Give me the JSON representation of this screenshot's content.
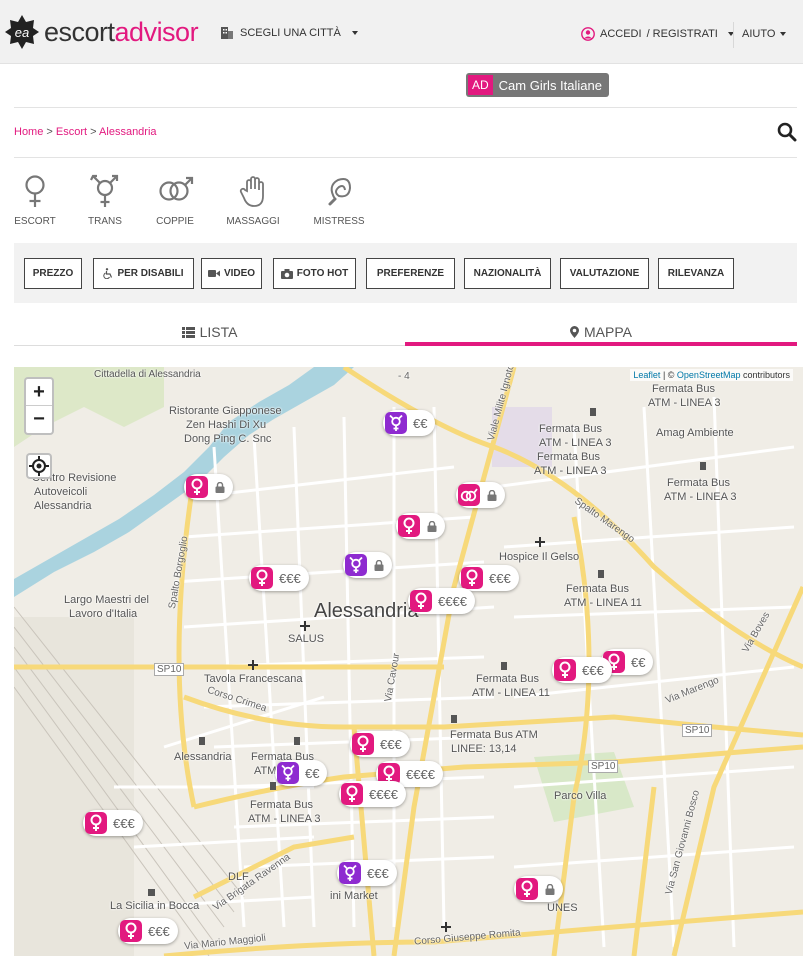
{
  "header": {
    "logo_part1": "escort",
    "logo_part2": "advisor",
    "logo_badge": "ea",
    "city_label": "SCEGLI UNA CITTÀ",
    "login_label": "ACCEDI",
    "register_label": "/ REGISTRATI",
    "help_label": "AIUTO"
  },
  "ad": {
    "tag": "AD",
    "label": "Cam Girls Italiane"
  },
  "breadcrumb": {
    "home": "Home",
    "sep": ">",
    "escort": "Escort",
    "city": "Alessandria"
  },
  "categories": [
    "ESCORT",
    "TRANS",
    "COPPIE",
    "MASSAGGI",
    "MISTRESS"
  ],
  "filters": [
    "PREZZO",
    "PER DISABILI",
    "VIDEO",
    "FOTO HOT",
    "PREFERENZE",
    "NAZIONALITÀ",
    "VALUTAZIONE",
    "RILEVANZA"
  ],
  "tabs": {
    "list": "LISTA",
    "map": "MAPPA"
  },
  "map": {
    "zoom_in": "+",
    "zoom_out": "−",
    "attribution_leaflet": "Leaflet",
    "attribution_sep": " | © ",
    "attribution_osm": "OpenStreetMap",
    "attribution_tail": " contributors",
    "city_name": "Alessandria",
    "labels": {
      "l1": "Ristorante Giapponese",
      "l2": "Zen Hashi Di Xu",
      "l3": "Dong Ping C. Snc",
      "l4": "Centro Revisione",
      "l5": "Autoveicoli",
      "l6": "Alessandria",
      "l7": "Largo Maestri del",
      "l8": "Lavoro d'Italia",
      "l9": "SALUS",
      "l10": "Tavola Francescana",
      "l11": "Corso Crimea",
      "l12": "Hospice Il Gelso",
      "l13": "Fermata Bus",
      "l14": "ATM - LINEA 3",
      "l15": "Amag Ambiente",
      "l16": "Fermata Bus",
      "l17": "ATM - LINEA 11",
      "l18": "Parco Villa",
      "l19": "Via Marengo",
      "l20": "Spalto Marengo",
      "l21": "Via Cavour",
      "l22": "Spalto Borgoglio",
      "l23": "Viale Milite Ignoto",
      "l24": "Via Brigata Ravenna",
      "l25": "Via Mario Maggioli",
      "l26": "Corso Giuseppe Romita",
      "l27": "La Sicilia in Bocca",
      "l28": "DLF",
      "l29": "SP10",
      "l30": "Via Boves",
      "l31": "Cittadella di Alessandria",
      "l32": "Via San Giovanni Bosco",
      "l33": "ini Market",
      "l34": "UNES",
      "l35": "Fermata Bus ATM",
      "l36": "LINEE: 13,14"
    },
    "markers": [
      {
        "type": "trans",
        "price": "€€"
      },
      {
        "type": "escort",
        "price": ""
      },
      {
        "type": "coppie",
        "price": ""
      },
      {
        "type": "escort",
        "price": ""
      },
      {
        "type": "trans",
        "price": ""
      },
      {
        "type": "escort",
        "price": "€€€"
      },
      {
        "type": "escort",
        "price": "€€€"
      },
      {
        "type": "escort",
        "price": "€€€€"
      },
      {
        "type": "escort",
        "price": "€€"
      },
      {
        "type": "escort",
        "price": "€€€"
      },
      {
        "type": "escort",
        "price": "€€€"
      },
      {
        "type": "trans",
        "price": "€€"
      },
      {
        "type": "escort",
        "price": "€€€€"
      },
      {
        "type": "escort",
        "price": "€€€€"
      },
      {
        "type": "escort",
        "price": "€€€"
      },
      {
        "type": "trans",
        "price": "€€€"
      },
      {
        "type": "escort",
        "price": ""
      },
      {
        "type": "escort",
        "price": "€€€"
      }
    ]
  },
  "colors": {
    "brand": "#e2197f",
    "trans": "#8e2bd0",
    "road_major": "#f7d97a"
  }
}
